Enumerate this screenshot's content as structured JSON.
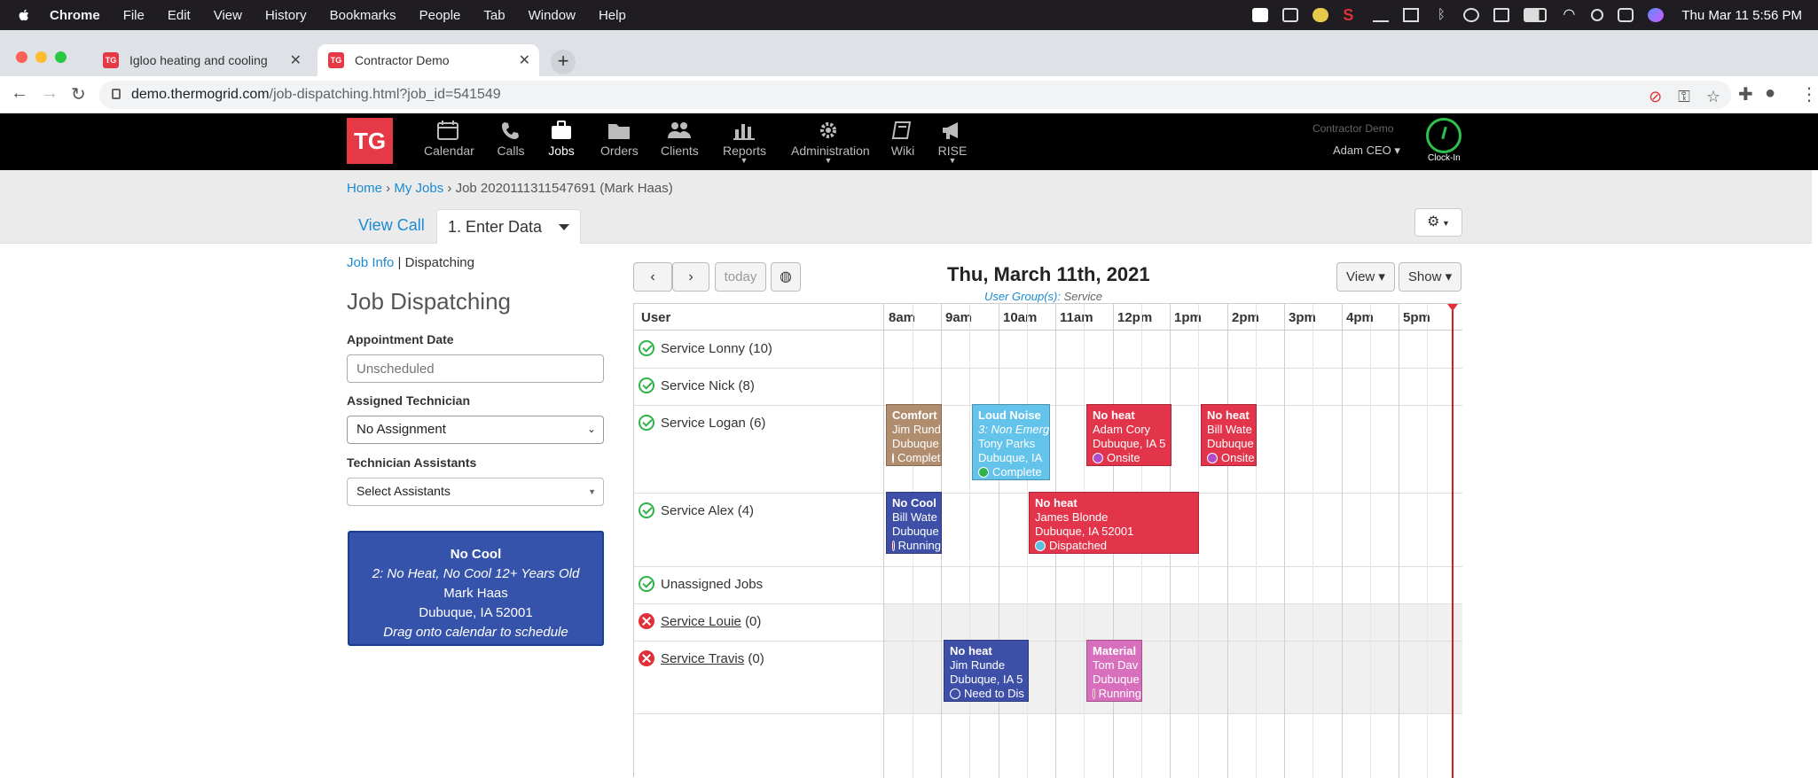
{
  "menubar": {
    "app": "Chrome",
    "items": [
      "File",
      "Edit",
      "View",
      "History",
      "Bookmarks",
      "People",
      "Tab",
      "Window",
      "Help"
    ],
    "clock": "Thu Mar 11  5:56 PM"
  },
  "browser": {
    "tabs": [
      {
        "label": "Igloo heating and cooling",
        "favicon": "TG"
      },
      {
        "label": "Contractor Demo",
        "favicon": "TG"
      }
    ],
    "url_host": "demo.thermogrid.com",
    "url_path": "/job-dispatching.html?job_id=541549"
  },
  "appnav": {
    "logo": "TG",
    "items": [
      {
        "label": "Calendar",
        "icon": "calendar-icon"
      },
      {
        "label": "Calls",
        "icon": "phone-icon"
      },
      {
        "label": "Jobs",
        "icon": "briefcase-icon"
      },
      {
        "label": "Orders",
        "icon": "folder-icon"
      },
      {
        "label": "Clients",
        "icon": "users-icon"
      },
      {
        "label": "Reports",
        "icon": "bar-chart-icon"
      },
      {
        "label": "Administration",
        "icon": "gear-icon"
      },
      {
        "label": "Wiki",
        "icon": "book-icon"
      },
      {
        "label": "RISE",
        "icon": "megaphone-icon"
      }
    ],
    "company": "Contractor Demo",
    "user": "Adam CEO ▾",
    "clockin": "Clock-In"
  },
  "breadcrumb": {
    "home": "Home",
    "sep1": " › ",
    "myjobs": "My Jobs",
    "sep2": " › ",
    "current": "Job 2020111311547691 (Mark Haas)"
  },
  "subtabs": {
    "view_call": "View Call",
    "enter_data": "1. Enter Data"
  },
  "left": {
    "job_info": "Job Info",
    "sep": " | ",
    "dispatching": "Dispatching",
    "heading": "Job Dispatching",
    "appt_label": "Appointment Date",
    "appt_placeholder": "Unscheduled",
    "tech_label": "Assigned Technician",
    "tech_value": "No Assignment",
    "assist_label": "Technician Assistants",
    "assist_value": "Select Assistants",
    "card": {
      "title": "No Cool",
      "line1": "2: No Heat, No Cool 12+ Years Old",
      "line2": "Mark Haas",
      "line3": "Dubuque, IA 52001",
      "line4": "Drag onto calendar to schedule"
    }
  },
  "calendar": {
    "today": "today",
    "title": "Thu, March 11th, 2021",
    "groups_label": "User Group(s):",
    "groups_value": "Service",
    "view_btn": "View ▾",
    "show_btn": "Show ▾",
    "user_header": "User",
    "hours": [
      "8am",
      "9am",
      "10am",
      "11am",
      "12pm",
      "1pm",
      "2pm",
      "3pm",
      "4pm",
      "5pm"
    ],
    "users": [
      {
        "name": "Service Lonny",
        "count": "(10)"
      },
      {
        "name": "Service Nick",
        "count": "(8)"
      },
      {
        "name": "Service Logan",
        "count": "(6)"
      },
      {
        "name": "Service Alex",
        "count": "(4)"
      },
      {
        "name": "Unassigned Jobs",
        "count": ""
      },
      {
        "name": "Service Louie",
        "count": "(0)"
      },
      {
        "name": "Service Travis",
        "count": "(0)"
      }
    ],
    "events": [
      {
        "title": "Comfort",
        "l1": "Jim Rund",
        "l2": "Dubuque",
        "status": "Complete"
      },
      {
        "title": "Loud Noise",
        "l1": "3: Non Emerg",
        "l2": "Tony Parks",
        "l3": "Dubuque, IA",
        "status": "Complete"
      },
      {
        "title": "No heat",
        "l1": "Adam Cory",
        "l2": "Dubuque, IA 5",
        "status": "Onsite"
      },
      {
        "title": "No heat",
        "l1": "Bill Wate",
        "l2": "Dubuque",
        "status": "Onsite"
      },
      {
        "title": "No Cool",
        "l1": "Bill Wate",
        "l2": "Dubuque",
        "status": "Running"
      },
      {
        "title": "No heat",
        "l1": "James Blonde",
        "l2": "Dubuque, IA 52001",
        "status": "Dispatched"
      },
      {
        "title": "No heat",
        "l1": "Jim Runde",
        "l2": "Dubuque, IA 5",
        "status": "Need to Dis"
      },
      {
        "title": "Material",
        "l1": "Tom Dav",
        "l2": "Dubuque",
        "status": "Running"
      }
    ]
  }
}
